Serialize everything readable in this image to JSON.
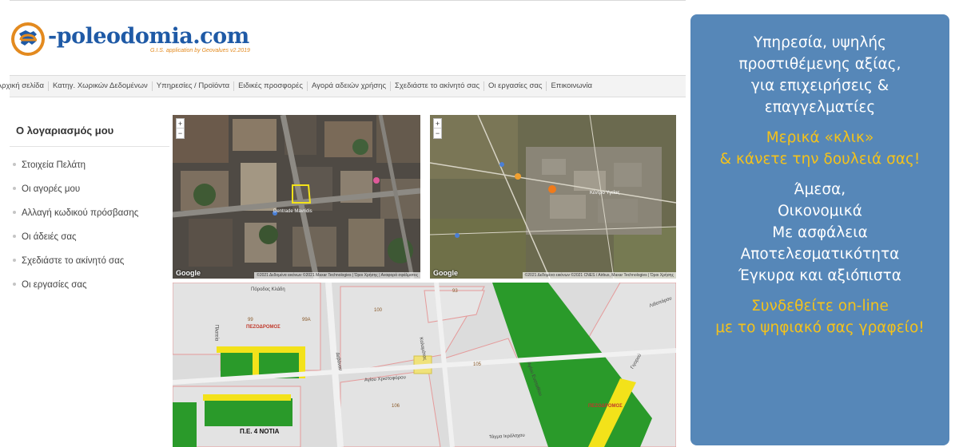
{
  "logo": {
    "text": "-poleodomia.com",
    "tagline": "G.I.S. application by Geovalues v2.2019"
  },
  "nav": {
    "items": [
      "Αρχική σελίδα",
      "Κατηγ. Χωρικών Δεδομένων",
      "Υπηρεσίες / Προϊόντα",
      "Ειδικές προσφορές",
      "Αγορά αδειών χρήσης",
      "Σχεδιάστε το ακίνητό σας",
      "Οι εργασίες σας",
      "Επικοινωνία"
    ]
  },
  "sidebar": {
    "title": "Ο λογαριασμός μου",
    "items": [
      "Στοιχεία Πελάτη",
      "Οι αγορές μου",
      "Αλλαγή κωδικού πρόσβασης",
      "Οι άδειές σας",
      "Σχεδιάστε το ακίνητό σας",
      "Οι εργασίες σας"
    ]
  },
  "maps": {
    "zoom_in": "+",
    "zoom_out": "−",
    "watermark": "Google",
    "sat1_attribution": "©2021 Δεδομένα εικόνων ©2021 Maxar Technologies | Όροι Χρήσης | Αναφορά σφάλματος",
    "sat2_attribution": "©2021 Δεδομένα εικόνων ©2021 CNES / Airbus, Maxar Technologies | Όροι Χρήσης",
    "sat1_place": "Dentrade Mavridis",
    "sat2_place": "Κέντρο Υγείας",
    "cadastral": {
      "streets": [
        "Πόροδος Κλάδη",
        "Πλατεία",
        "Δεβάνου",
        "Αγίου Χριστοφόρου",
        "Καλαμάτας",
        "Αγίου Ευσταθίου",
        "Γιγορού",
        "Λιθοπόρου",
        "Τάγμα Ιερόλοχου"
      ],
      "parcels": [
        "99",
        "99A",
        "100",
        "93",
        "105",
        "106"
      ],
      "blocks": [
        "ΠΕΖΟΔΡΟΜΟΣ",
        "ΠΕΖΟΔΡΟΜΟΣ"
      ],
      "zone_label": "Π.Ε. 4 ΝΟΤΙΑ"
    }
  },
  "promo": {
    "intro": [
      "Υπηρεσία, υψηλής",
      "προστιθέμενης αξίας,",
      "για επιχειρήσεις &",
      "επαγγελματίες"
    ],
    "highlight1": [
      "Μερικά «κλικ»",
      "& κάνετε την δουλειά σας!"
    ],
    "benefits": [
      "Άμεσα,",
      "Οικονομικά",
      "Με ασφάλεια",
      "Αποτελεσματικότητα",
      "Έγκυρα και αξιόπιστα"
    ],
    "highlight2": [
      "Συνδεθείτε on-line",
      "με το ψηφιακό σας γραφείο!"
    ]
  },
  "colors": {
    "promo_bg": "#5687b8",
    "promo_highlight": "#f4c21b",
    "logo_blue": "#1f5aa6",
    "logo_orange": "#e38a1f",
    "green_zone": "#2a9a2a",
    "road_yellow": "#f3e21a"
  }
}
